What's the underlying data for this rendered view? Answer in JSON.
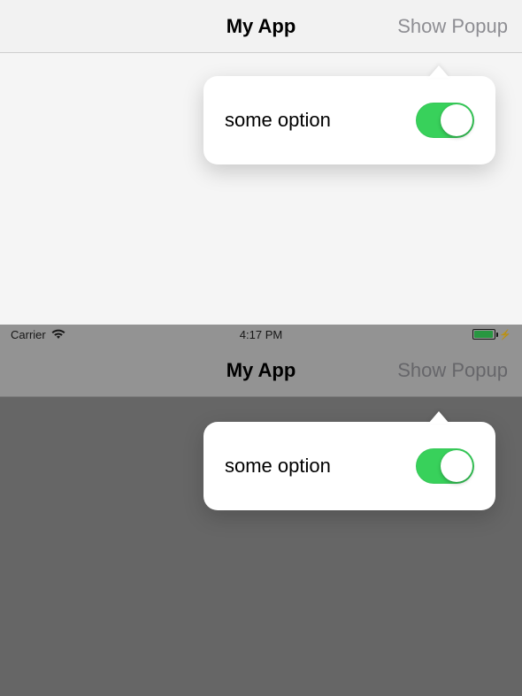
{
  "top": {
    "nav": {
      "title": "My App",
      "right_button": "Show Popup"
    },
    "popover": {
      "option_label": "some option",
      "switch_on": true
    }
  },
  "bottom": {
    "status": {
      "carrier": "Carrier",
      "time": "4:17 PM",
      "battery_percent": 85,
      "charging": true
    },
    "nav": {
      "title": "My App",
      "right_button": "Show Popup"
    },
    "popover": {
      "option_label": "some option",
      "switch_on": true
    }
  }
}
